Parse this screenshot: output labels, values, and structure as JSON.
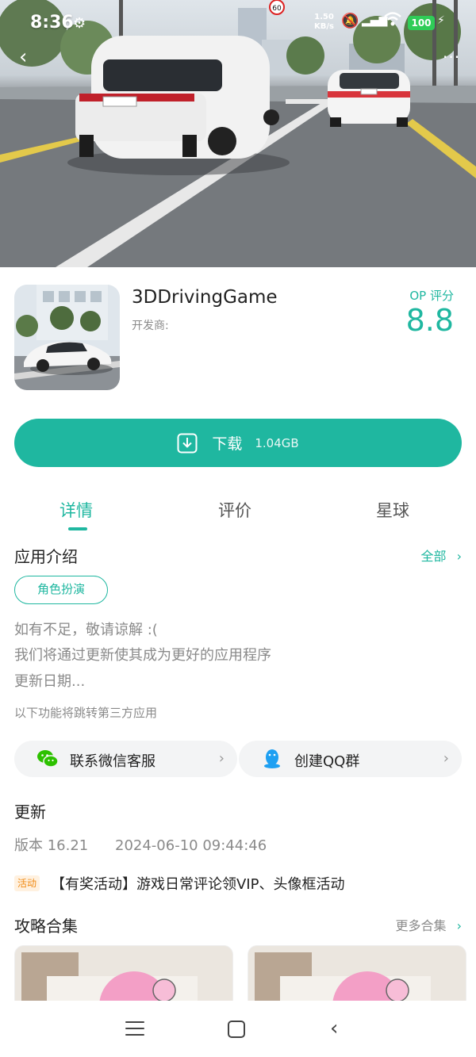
{
  "status_bar": {
    "time": "8:36",
    "net_speed_value": "1.50",
    "net_speed_unit": "KB/s",
    "battery": "100"
  },
  "hero": {
    "speed_sign": "60",
    "back_icon": "back-arrow-icon",
    "more_icon": "more-icon"
  },
  "app": {
    "name": "3DDrivingGame",
    "developer_label": "开发商:",
    "rating_label": "OP 评分",
    "rating_value": "8.8"
  },
  "download": {
    "label": "下载",
    "size": "1.04GB"
  },
  "tabs": [
    {
      "label": "详情",
      "active": true
    },
    {
      "label": "评价",
      "active": false
    },
    {
      "label": "星球",
      "active": false
    }
  ],
  "intro": {
    "title": "应用介绍",
    "all_label": "全部",
    "tag": "角色扮演",
    "lines": [
      "如有不足，敬请谅解 :(",
      "我们将通过更新使其成为更好的应用程序",
      "更新日期..."
    ],
    "third_party_note": "以下功能将跳转第三方应用"
  },
  "contacts": [
    {
      "label": "联系微信客服",
      "icon": "wechat-icon"
    },
    {
      "label": "创建QQ群",
      "icon": "qq-icon"
    }
  ],
  "update": {
    "title": "更新",
    "version": "版本 16.21",
    "date": "2024-06-10 09:44:46",
    "activity_badge": "活动",
    "activity_text": "【有奖活动】游戏日常评论领VIP、头像框活动"
  },
  "guides": {
    "title": "攻略合集",
    "more_label": "更多合集"
  },
  "colors": {
    "accent": "#1fb7a0",
    "activity": "#f08a14",
    "battery": "#2fcc57"
  }
}
